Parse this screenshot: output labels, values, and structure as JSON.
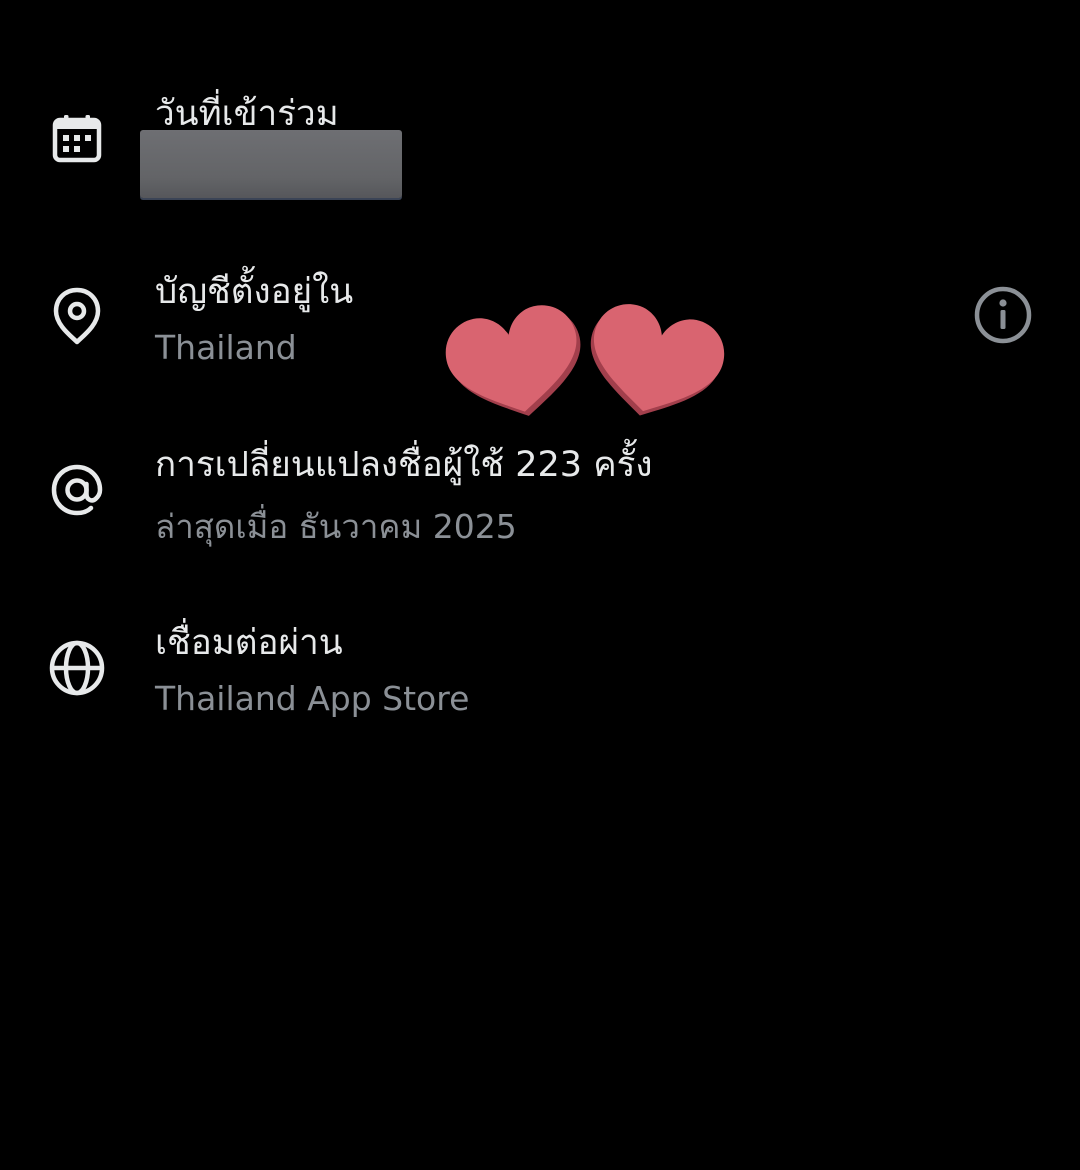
{
  "join_date": {
    "icon": "calendar-icon",
    "label": "วันที่เข้าร่วม"
  },
  "account_location": {
    "icon": "location-pin-icon",
    "label": "บัญชีตั้งอยู่ใน",
    "value": "Thailand",
    "info_icon": "info-icon"
  },
  "username_changes": {
    "icon": "at-sign-icon",
    "label": "การเปลี่ยนแปลงชื่อผู้ใช้ 223 ครั้ง",
    "value": "ล่าสุดเมื่อ ธันวาคม 2025"
  },
  "connected_via": {
    "icon": "globe-icon",
    "label": "เชื่อมต่อผ่าน",
    "value": "Thailand App Store"
  },
  "colors": {
    "background": "#000000",
    "primary_text": "#e7e9ea",
    "secondary_text": "#8b9096",
    "heart": "#d96470",
    "redaction": "#6a6b6f"
  }
}
